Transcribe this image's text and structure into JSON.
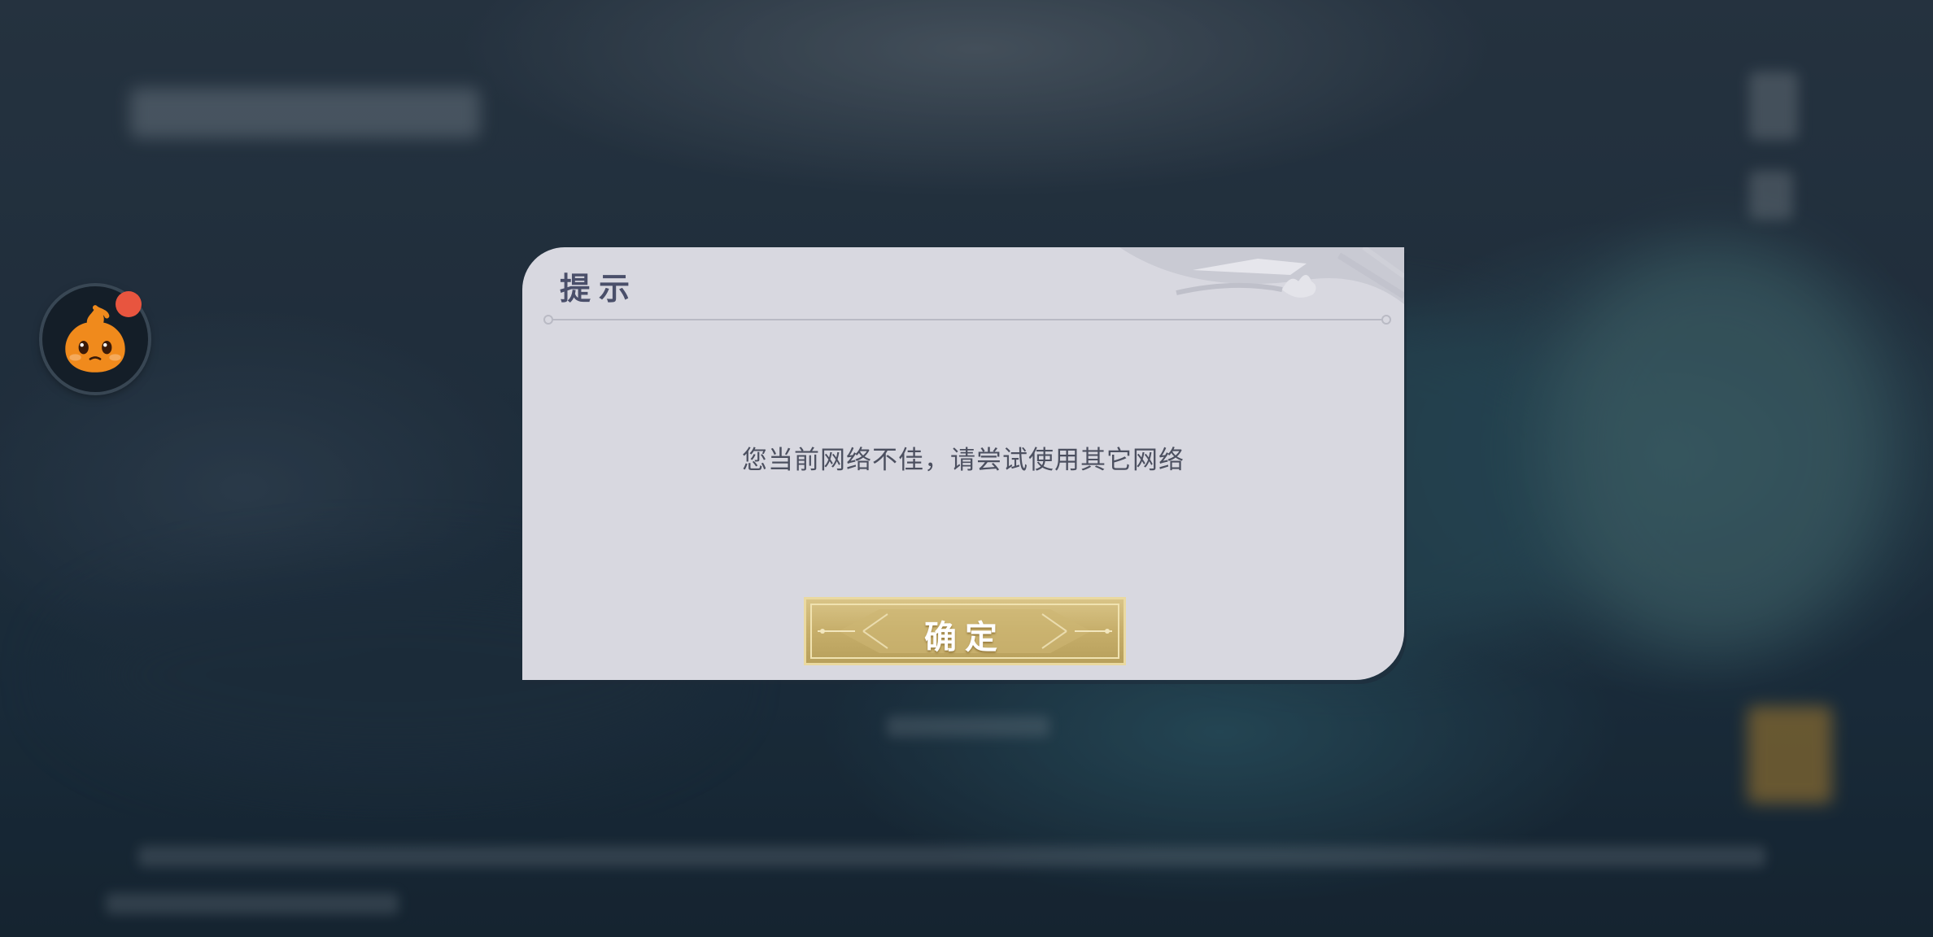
{
  "dialog": {
    "title": "提示",
    "message": "您当前网络不佳，请尝试使用其它网络",
    "confirm_label": "确定"
  },
  "floating_assistant": {
    "icon": "mascot-icon",
    "has_notification": true
  },
  "colors": {
    "dialog_bg": "#d8d8e0",
    "title": "#4a4f6a",
    "button_gold": "#c6ae6a",
    "notification": "#e8553f",
    "mascot": "#f08a1c"
  }
}
